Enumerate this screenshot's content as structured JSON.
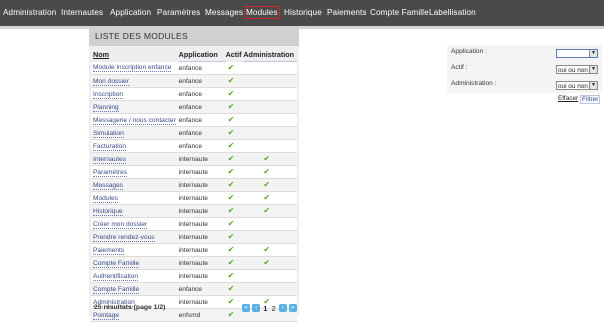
{
  "nav": {
    "items": [
      {
        "label": "Administration"
      },
      {
        "label": "Internautes"
      },
      {
        "label": "Application"
      },
      {
        "label": "Paramètres"
      },
      {
        "label": "Messages"
      },
      {
        "label": "Modules",
        "active": true
      },
      {
        "label": "Historique"
      },
      {
        "label": "Paiements"
      },
      {
        "label": "Compte Famille"
      },
      {
        "label": "Labellisation"
      }
    ]
  },
  "list": {
    "title": "LISTE DES MODULES",
    "columns": [
      "Nom",
      "Application",
      "Actif",
      "Administration"
    ],
    "rows": [
      {
        "nom": "Module inscription enfance",
        "application": "enfance",
        "actif": true,
        "administration": false
      },
      {
        "nom": "Mon dossier",
        "application": "enfance",
        "actif": true,
        "administration": false
      },
      {
        "nom": "Inscription",
        "application": "enfance",
        "actif": true,
        "administration": false
      },
      {
        "nom": "Planning",
        "application": "enfance",
        "actif": true,
        "administration": false
      },
      {
        "nom": "Messagerie / nous contacter",
        "application": "enfance",
        "actif": true,
        "administration": false
      },
      {
        "nom": "Simulation",
        "application": "enfance",
        "actif": true,
        "administration": false
      },
      {
        "nom": "Facturation",
        "application": "enfance",
        "actif": true,
        "administration": false
      },
      {
        "nom": "Internautes",
        "application": "internaute",
        "actif": true,
        "administration": true
      },
      {
        "nom": "Paramètres",
        "application": "internaute",
        "actif": true,
        "administration": true
      },
      {
        "nom": "Messages",
        "application": "internaute",
        "actif": true,
        "administration": true
      },
      {
        "nom": "Modules",
        "application": "internaute",
        "actif": true,
        "administration": true
      },
      {
        "nom": "Historique",
        "application": "internaute",
        "actif": true,
        "administration": true
      },
      {
        "nom": "Créer mon dossier",
        "application": "internaute",
        "actif": true,
        "administration": false
      },
      {
        "nom": "Prendre rendez-vous",
        "application": "internaute",
        "actif": true,
        "administration": false
      },
      {
        "nom": "Paiements",
        "application": "internaute",
        "actif": true,
        "administration": true
      },
      {
        "nom": "Compte Famille",
        "application": "internaute",
        "actif": true,
        "administration": true
      },
      {
        "nom": "Authentification",
        "application": "internaute",
        "actif": true,
        "administration": false
      },
      {
        "nom": "Compte Famille",
        "application": "enfance",
        "actif": true,
        "administration": false
      },
      {
        "nom": "Administration",
        "application": "internaute",
        "actif": true,
        "administration": true
      },
      {
        "nom": "Pointage",
        "application": "enfsmd",
        "actif": true,
        "administration": false
      }
    ],
    "footer": "25 résultats (page 1/2)",
    "pager": {
      "pages": [
        "1",
        "2"
      ],
      "current": "1"
    }
  },
  "filter": {
    "application_label": "Application :",
    "application_value": "",
    "actif_label": "Actif :",
    "actif_value": "oui ou non",
    "administration_label": "Administration :",
    "administration_value": "oui ou non",
    "effacer_label": "Effacer",
    "filtrer_label": "Filtrer"
  },
  "colors": {
    "nav_bg": "#4a4a4a",
    "active_outline": "#cc2a2a",
    "check": "#55aa22",
    "link": "#3a4a8a"
  },
  "icons": {
    "check": "check-icon",
    "pager_first": "first-page-icon",
    "pager_prev": "prev-page-icon",
    "pager_next": "next-page-icon",
    "pager_last": "last-page-icon",
    "select_arrow": "chevron-down-icon"
  }
}
